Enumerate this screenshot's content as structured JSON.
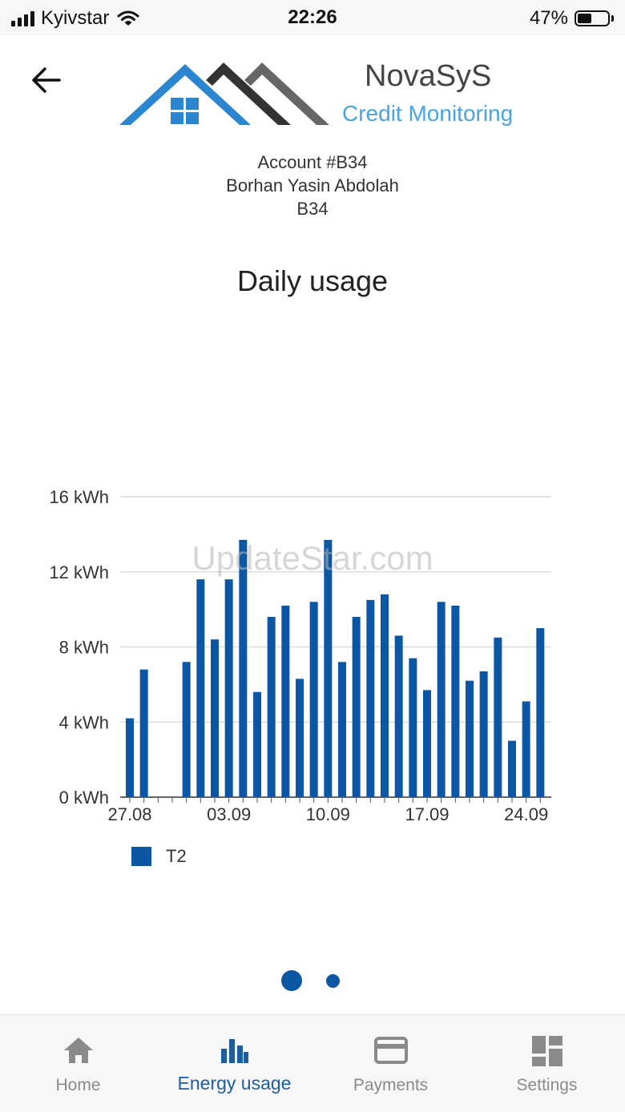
{
  "status_bar": {
    "carrier": "Kyivstar",
    "time": "22:26",
    "battery_percent": "47%",
    "battery_level": 0.47
  },
  "header": {
    "back_icon": "arrow-left-icon",
    "brand_name": "NovaSyS",
    "brand_tagline": "Credit Monitoring",
    "colors": {
      "roof_blue": "#2b86cf",
      "roof_dark": "#333333",
      "roof_grey": "#666666",
      "tagline": "#4aa3de"
    }
  },
  "account": {
    "title": "Account #B34",
    "owner": "Borhan Yasin Abdolah",
    "code": "B34"
  },
  "page_title": "Daily usage",
  "watermark": "UpdateStar.com",
  "chart_data": {
    "type": "bar",
    "ylim": [
      0,
      16
    ],
    "y_ticks": [
      "0 kWh",
      "4 kWh",
      "8 kWh",
      "12 kWh",
      "16 kWh"
    ],
    "x_tick_labels": [
      "27.08",
      "03.09",
      "10.09",
      "17.09",
      "24.09"
    ],
    "grid": true,
    "legend_position": "bottom-left",
    "series": [
      {
        "name": "T2",
        "color": "#0b57a4",
        "values": [
          4.2,
          6.8,
          null,
          null,
          7.2,
          11.6,
          8.4,
          11.6,
          13.7,
          5.6,
          9.6,
          10.2,
          6.3,
          10.4,
          13.7,
          7.2,
          9.6,
          10.5,
          10.8,
          8.6,
          7.4,
          5.7,
          10.4,
          10.2,
          6.2,
          6.7,
          8.5,
          3.0,
          5.1,
          9.0
        ]
      }
    ]
  },
  "pager": {
    "pages": 2,
    "active": 0
  },
  "bottom_nav": {
    "items": [
      {
        "label": "Home",
        "icon": "home-icon"
      },
      {
        "label": "Energy usage",
        "icon": "bar-chart-icon"
      },
      {
        "label": "Payments",
        "icon": "credit-card-icon"
      },
      {
        "label": "Settings",
        "icon": "dashboard-icon"
      }
    ],
    "active_index": 1,
    "active_color": "#1e5d9e",
    "inactive_color": "#8a8a8a"
  }
}
